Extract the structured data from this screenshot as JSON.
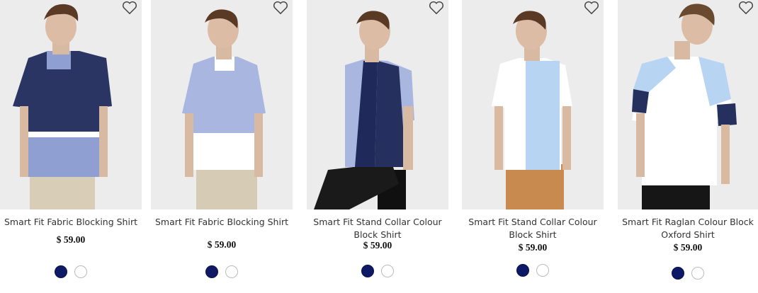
{
  "products": [
    {
      "name": "Smart Fit Fabric Blocking Shirt",
      "price": "$ 59.00",
      "colors": [
        "navy",
        "white"
      ],
      "swatch_hex": {
        "navy": "#0f1a66",
        "white": "#ffffff"
      }
    },
    {
      "name": "Smart Fit Fabric Blocking Shirt",
      "price": "$ 59.00",
      "colors": [
        "navy",
        "white"
      ],
      "swatch_hex": {
        "navy": "#0f1a66",
        "white": "#ffffff"
      }
    },
    {
      "name": "Smart Fit Stand Collar Colour Block Shirt",
      "price": "$ 59.00",
      "colors": [
        "navy",
        "white"
      ],
      "swatch_hex": {
        "navy": "#0f1a66",
        "white": "#ffffff"
      }
    },
    {
      "name": "Smart Fit Stand Collar Colour Block Shirt",
      "price": "$ 59.00",
      "colors": [
        "navy",
        "white"
      ],
      "swatch_hex": {
        "navy": "#0f1a66",
        "white": "#ffffff"
      }
    },
    {
      "name": "Smart Fit Raglan Colour Block Oxford Shirt",
      "price": "$ 59.00",
      "colors": [
        "navy",
        "white"
      ],
      "swatch_hex": {
        "navy": "#0f1a66",
        "white": "#ffffff"
      }
    }
  ],
  "icons": {
    "wishlist": "heart-outline-icon"
  }
}
